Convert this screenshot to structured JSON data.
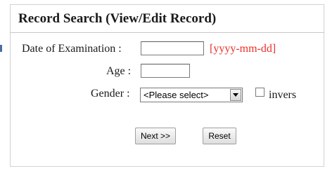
{
  "form": {
    "title": "Record Search (View/Edit Record)",
    "date_label": "Date of Examination :",
    "date_value": "",
    "date_hint": "[yyyy-mm-dd]",
    "age_label": "Age :",
    "age_value": "",
    "gender_label": "Gender :",
    "gender_selected": "<Please select>",
    "invers_label": "invers",
    "invers_checked": false,
    "next_label": "Next >>",
    "reset_label": "Reset"
  },
  "colors": {
    "hint": "#e8302c",
    "border": "#d2d2d2"
  }
}
